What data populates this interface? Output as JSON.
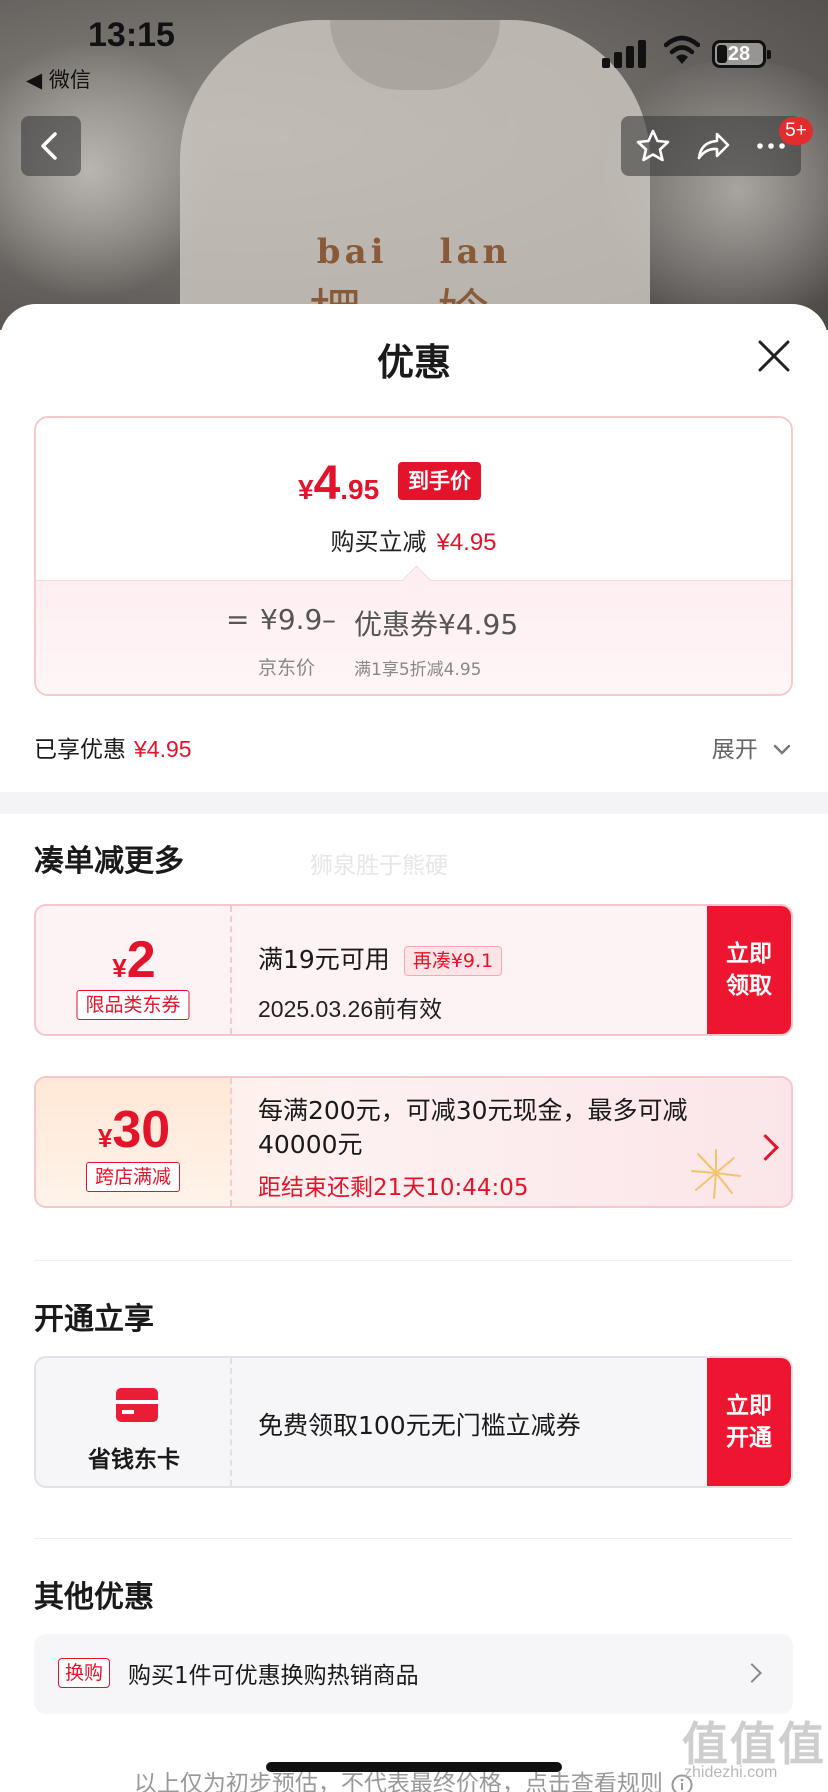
{
  "status_bar": {
    "time": "13:15",
    "back_app": "◀ 微信",
    "battery": "28"
  },
  "product_backdrop": {
    "pinyin": [
      "bai",
      "lan"
    ],
    "brand": "椤 娢"
  },
  "top_nav": {
    "cart_badge": "5+"
  },
  "sheet": {
    "title": "优惠",
    "price_card": {
      "final_symbol": "¥",
      "final_int": "4",
      "final_dec": ".95",
      "final_tag": "到手价",
      "reduce_label": "购买立减",
      "reduce_value": "¥4.95",
      "equals": "=",
      "jd_price": "¥9.9",
      "minus": "–",
      "coupon_label": "优惠券",
      "coupon_value": "¥4.95",
      "jd_price_label": "京东价",
      "coupon_desc": "满1享5折减4.95"
    },
    "enjoyed": {
      "label": "已享优惠",
      "value": "¥4.95",
      "expand": "展开"
    }
  },
  "more_section": {
    "title": "凑单减更多",
    "overlay_text": "狮泉胜于熊硬",
    "coupon1": {
      "symbol": "¥",
      "amount": "2",
      "category": "限品类东券",
      "condition": "满19元可用",
      "more_tag": "再凑¥9.1",
      "valid": "2025.03.26前有效",
      "button": "立即领取"
    },
    "coupon2": {
      "symbol": "¥",
      "amount": "30",
      "category": "跨店满减",
      "description": "每满200元，可减30元现金，最多可减40000元",
      "countdown": "距结束还剩21天10:44:05"
    }
  },
  "open_section": {
    "title": "开通立享",
    "card": {
      "icon": "card-icon",
      "name": "省钱东卡",
      "text": "免费领取100元无门槛立减券",
      "button": "立即开通"
    }
  },
  "other_section": {
    "title": "其他优惠",
    "tag": "换购",
    "text": "购买1件可优惠换购热销商品"
  },
  "disclaimer": "以上仅为初步预估，不代表最终价格，点击查看规则",
  "watermark": {
    "mark": "值值值",
    "url": "zhidezhi.com"
  },
  "colors": {
    "accent": "#e3132b",
    "button": "#ee1530",
    "border_pink": "#f4c7cc"
  }
}
